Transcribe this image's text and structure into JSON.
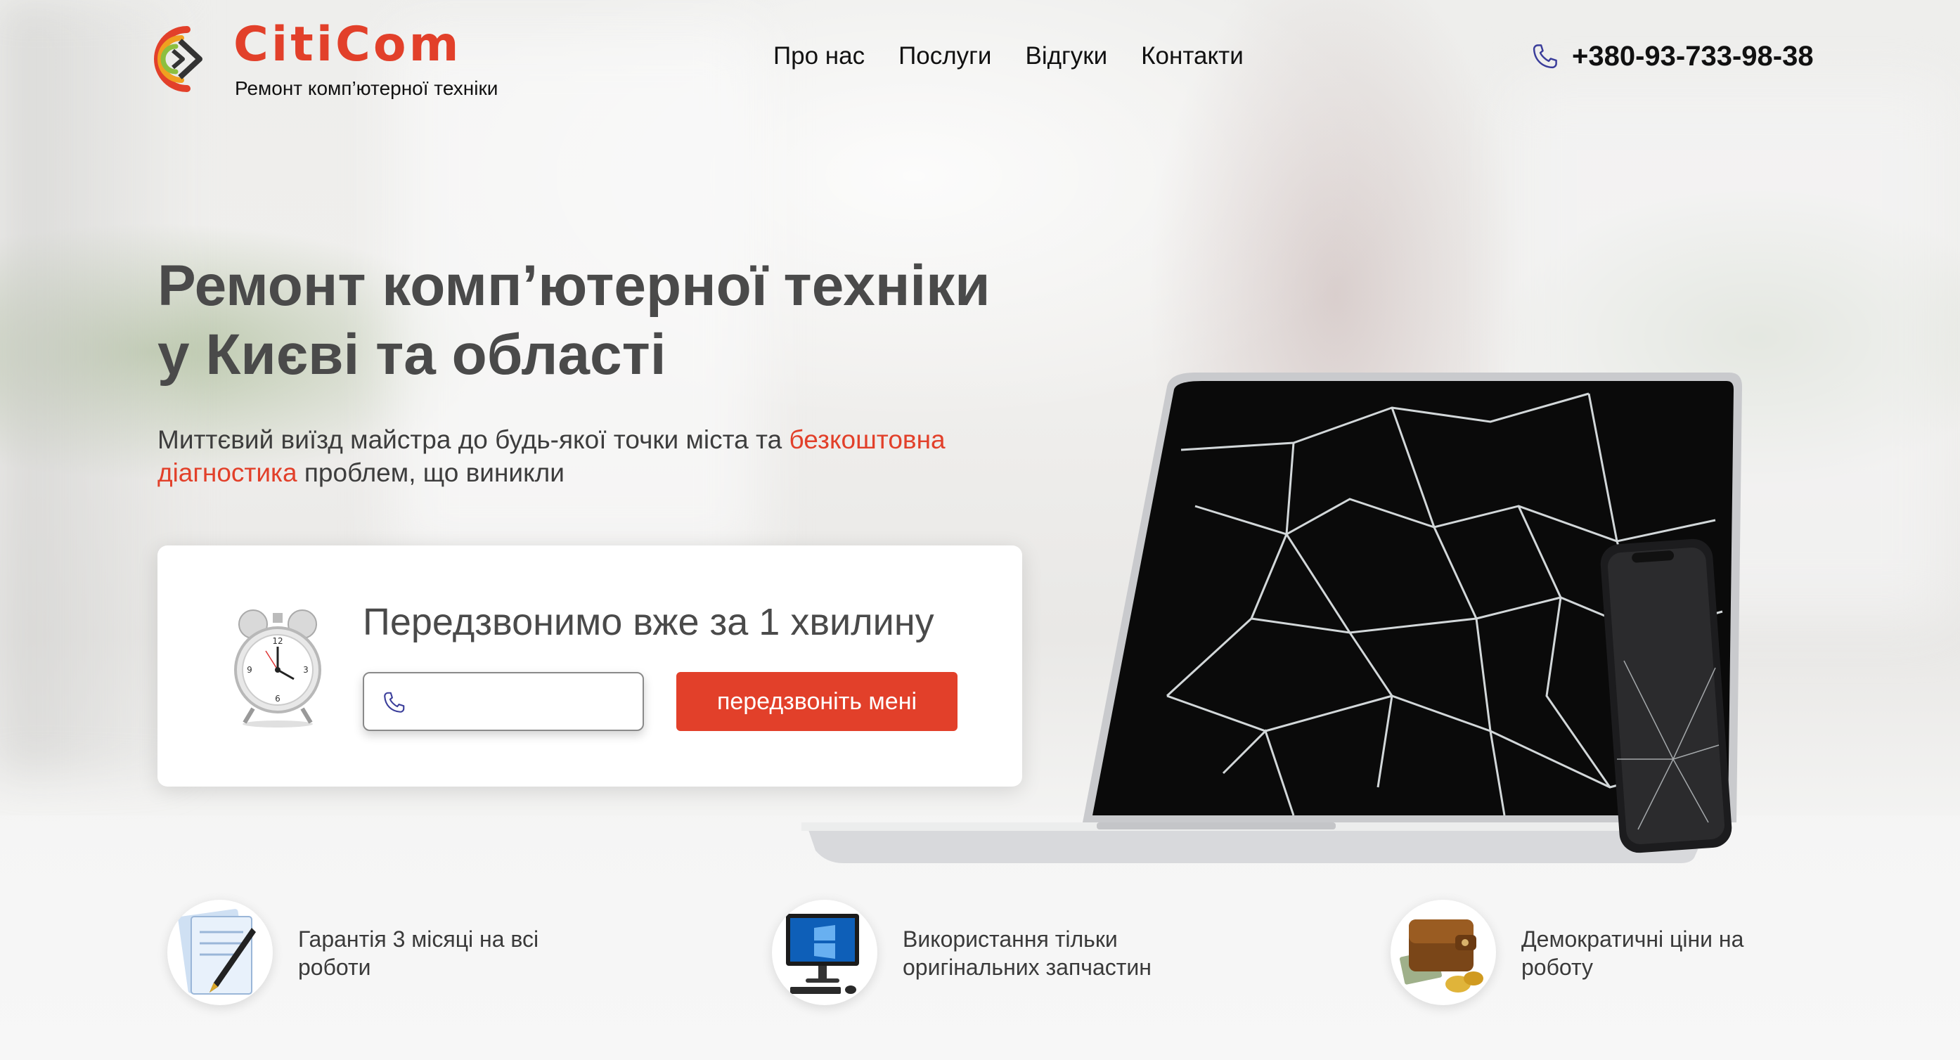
{
  "brand": {
    "name": "CitiCom",
    "tagline": "Ремонт комп’ютерної техніки",
    "accent_color": "#e2402a",
    "logo_icon": "citicom-logo-icon"
  },
  "nav": {
    "items": [
      {
        "label": "Про нас"
      },
      {
        "label": "Послуги"
      },
      {
        "label": "Відгуки"
      },
      {
        "label": "Контакти"
      }
    ]
  },
  "header": {
    "phone": "+380-93-733-98-38",
    "phone_icon": "phone-icon"
  },
  "hero": {
    "title_line1": "Ремонт комп’ютерної техніки",
    "title_line2": "у Києві та області",
    "subtitle_part1": "Миттєвий виїзд майстра до будь-якої точки міста та ",
    "subtitle_accent": "безкоштовна діагностика",
    "subtitle_part2": " проблем, що виникли"
  },
  "callback": {
    "title": "Передзвонимо вже за 1 хвилину",
    "input_value": "",
    "input_placeholder": "",
    "button_label": "передзвоніть мені",
    "icon": "alarm-clock-icon"
  },
  "features": [
    {
      "icon": "document-pen-icon",
      "text": "Гарантія 3 місяці на всі роботи"
    },
    {
      "icon": "desktop-computer-icon",
      "text": "Використання тільки оригінальних запчастин"
    },
    {
      "icon": "wallet-coins-icon",
      "text": "Демократичні ціни на роботу"
    }
  ]
}
